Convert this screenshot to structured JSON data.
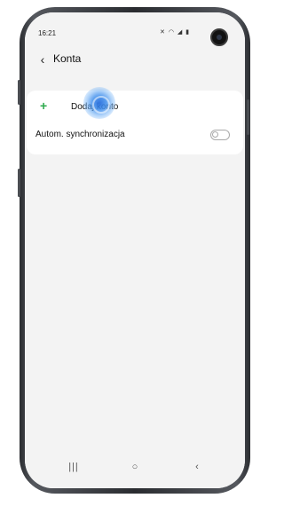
{
  "status_bar": {
    "time": "16:21",
    "icons": [
      "mute-icon",
      "wifi-icon",
      "signal-icon",
      "battery-icon"
    ]
  },
  "header": {
    "title": "Konta",
    "back_icon": "chevron-left-icon"
  },
  "list": {
    "add_account_label": "Dodaj konto",
    "add_icon": "plus-icon",
    "add_icon_color": "#2eaa4e",
    "auto_sync_label": "Autom. synchronizacja",
    "auto_sync_enabled": false
  },
  "navigation_bar": {
    "recent": "|||",
    "home": "○",
    "back": "‹"
  }
}
